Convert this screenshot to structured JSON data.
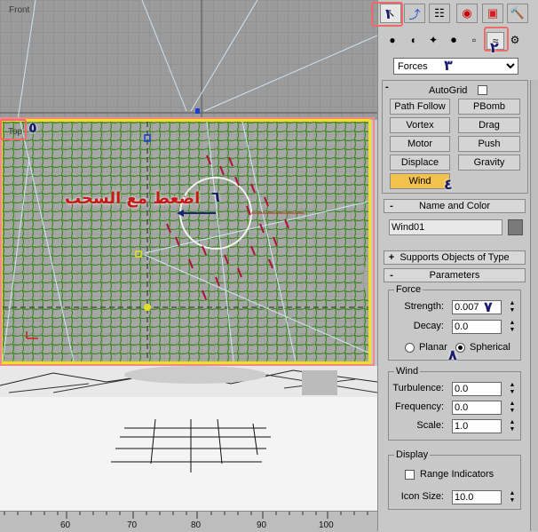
{
  "viewports": {
    "front_label": "Front",
    "top_label": "Top",
    "instruction": "اضغط مع السحب",
    "ruler": [
      "60",
      "70",
      "80",
      "90",
      "100"
    ]
  },
  "badges": {
    "b1": "١",
    "b2": "٢",
    "b3": "٣",
    "b4": "٤",
    "b5": "٥",
    "b6": "٦",
    "b7": "٧",
    "b8": "٨"
  },
  "panel": {
    "tabs": [
      "create-icon",
      "modify-icon",
      "hierarchy-icon",
      "motion-icon",
      "display-icon",
      "utilities-icon"
    ],
    "subtabs": [
      "geometry-icon",
      "shapes-icon",
      "lights-icon",
      "cameras-icon",
      "helpers-icon",
      "space-warps-icon",
      "systems-icon"
    ],
    "category": "Forces",
    "object_type": {
      "autogrid": "AutoGrid",
      "buttons": [
        "Path Follow",
        "PBomb",
        "Vortex",
        "Drag",
        "Motor",
        "Push",
        "Displace",
        "Gravity",
        "Wind"
      ]
    },
    "name_and_color": {
      "title": "Name and Color",
      "name": "Wind01",
      "swatch": "#7a7a7a"
    },
    "supports": {
      "title": "Supports Objects of Type",
      "sign": "+"
    },
    "parameters": {
      "title": "Parameters",
      "sign": "-",
      "force_group": "Force",
      "strength_label": "Strength:",
      "strength": "0.007",
      "decay_label": "Decay:",
      "decay": "0.0",
      "planar": "Planar",
      "spherical": "Spherical",
      "wind_group": "Wind",
      "turbulence_label": "Turbulence:",
      "turbulence": "0.0",
      "frequency_label": "Frequency:",
      "frequency": "0.0",
      "scale_label": "Scale:",
      "scale": "1.0",
      "display_group": "Display",
      "range_indicators": "Range Indicators",
      "icon_size_label": "Icon Size:",
      "icon_size": "10.0"
    },
    "object_type_sign": "-",
    "name_sign": "-"
  },
  "colors": {
    "accent_highlight": "#f06a6a",
    "active_viewport": "#f0e020",
    "selected_button": "#f2c14e",
    "mesh": "#3c8a1e",
    "particles": "#b0103c"
  }
}
